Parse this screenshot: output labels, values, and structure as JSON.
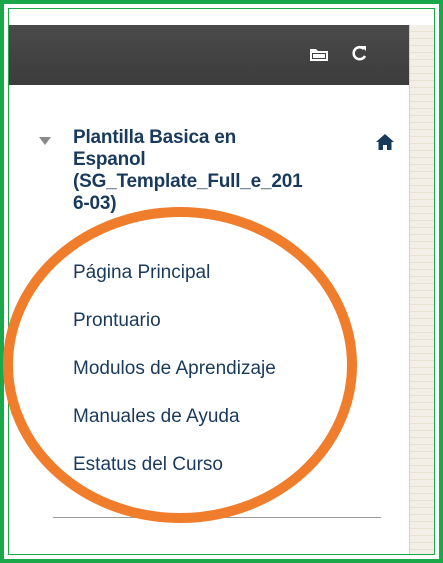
{
  "course": {
    "title": "Plantilla Basica en\nEspanol\n(SG_Template_Full_e_201\n6-03)"
  },
  "nav": {
    "items": [
      {
        "label": "Página Principal"
      },
      {
        "label": "Prontuario"
      },
      {
        "label": "Modulos de Aprendizaje"
      },
      {
        "label": "Manuales de Ayuda"
      },
      {
        "label": "Estatus del Curso"
      }
    ]
  },
  "icons": {
    "folder": "folder-icon",
    "refresh": "refresh-icon",
    "home": "home-icon",
    "toggle": "triangle-down-icon"
  },
  "colors": {
    "frame_border": "#1aa84a",
    "topbar": "#3f3f3f",
    "link_text": "#1a3a5c",
    "annotation": "#f07d2c"
  }
}
